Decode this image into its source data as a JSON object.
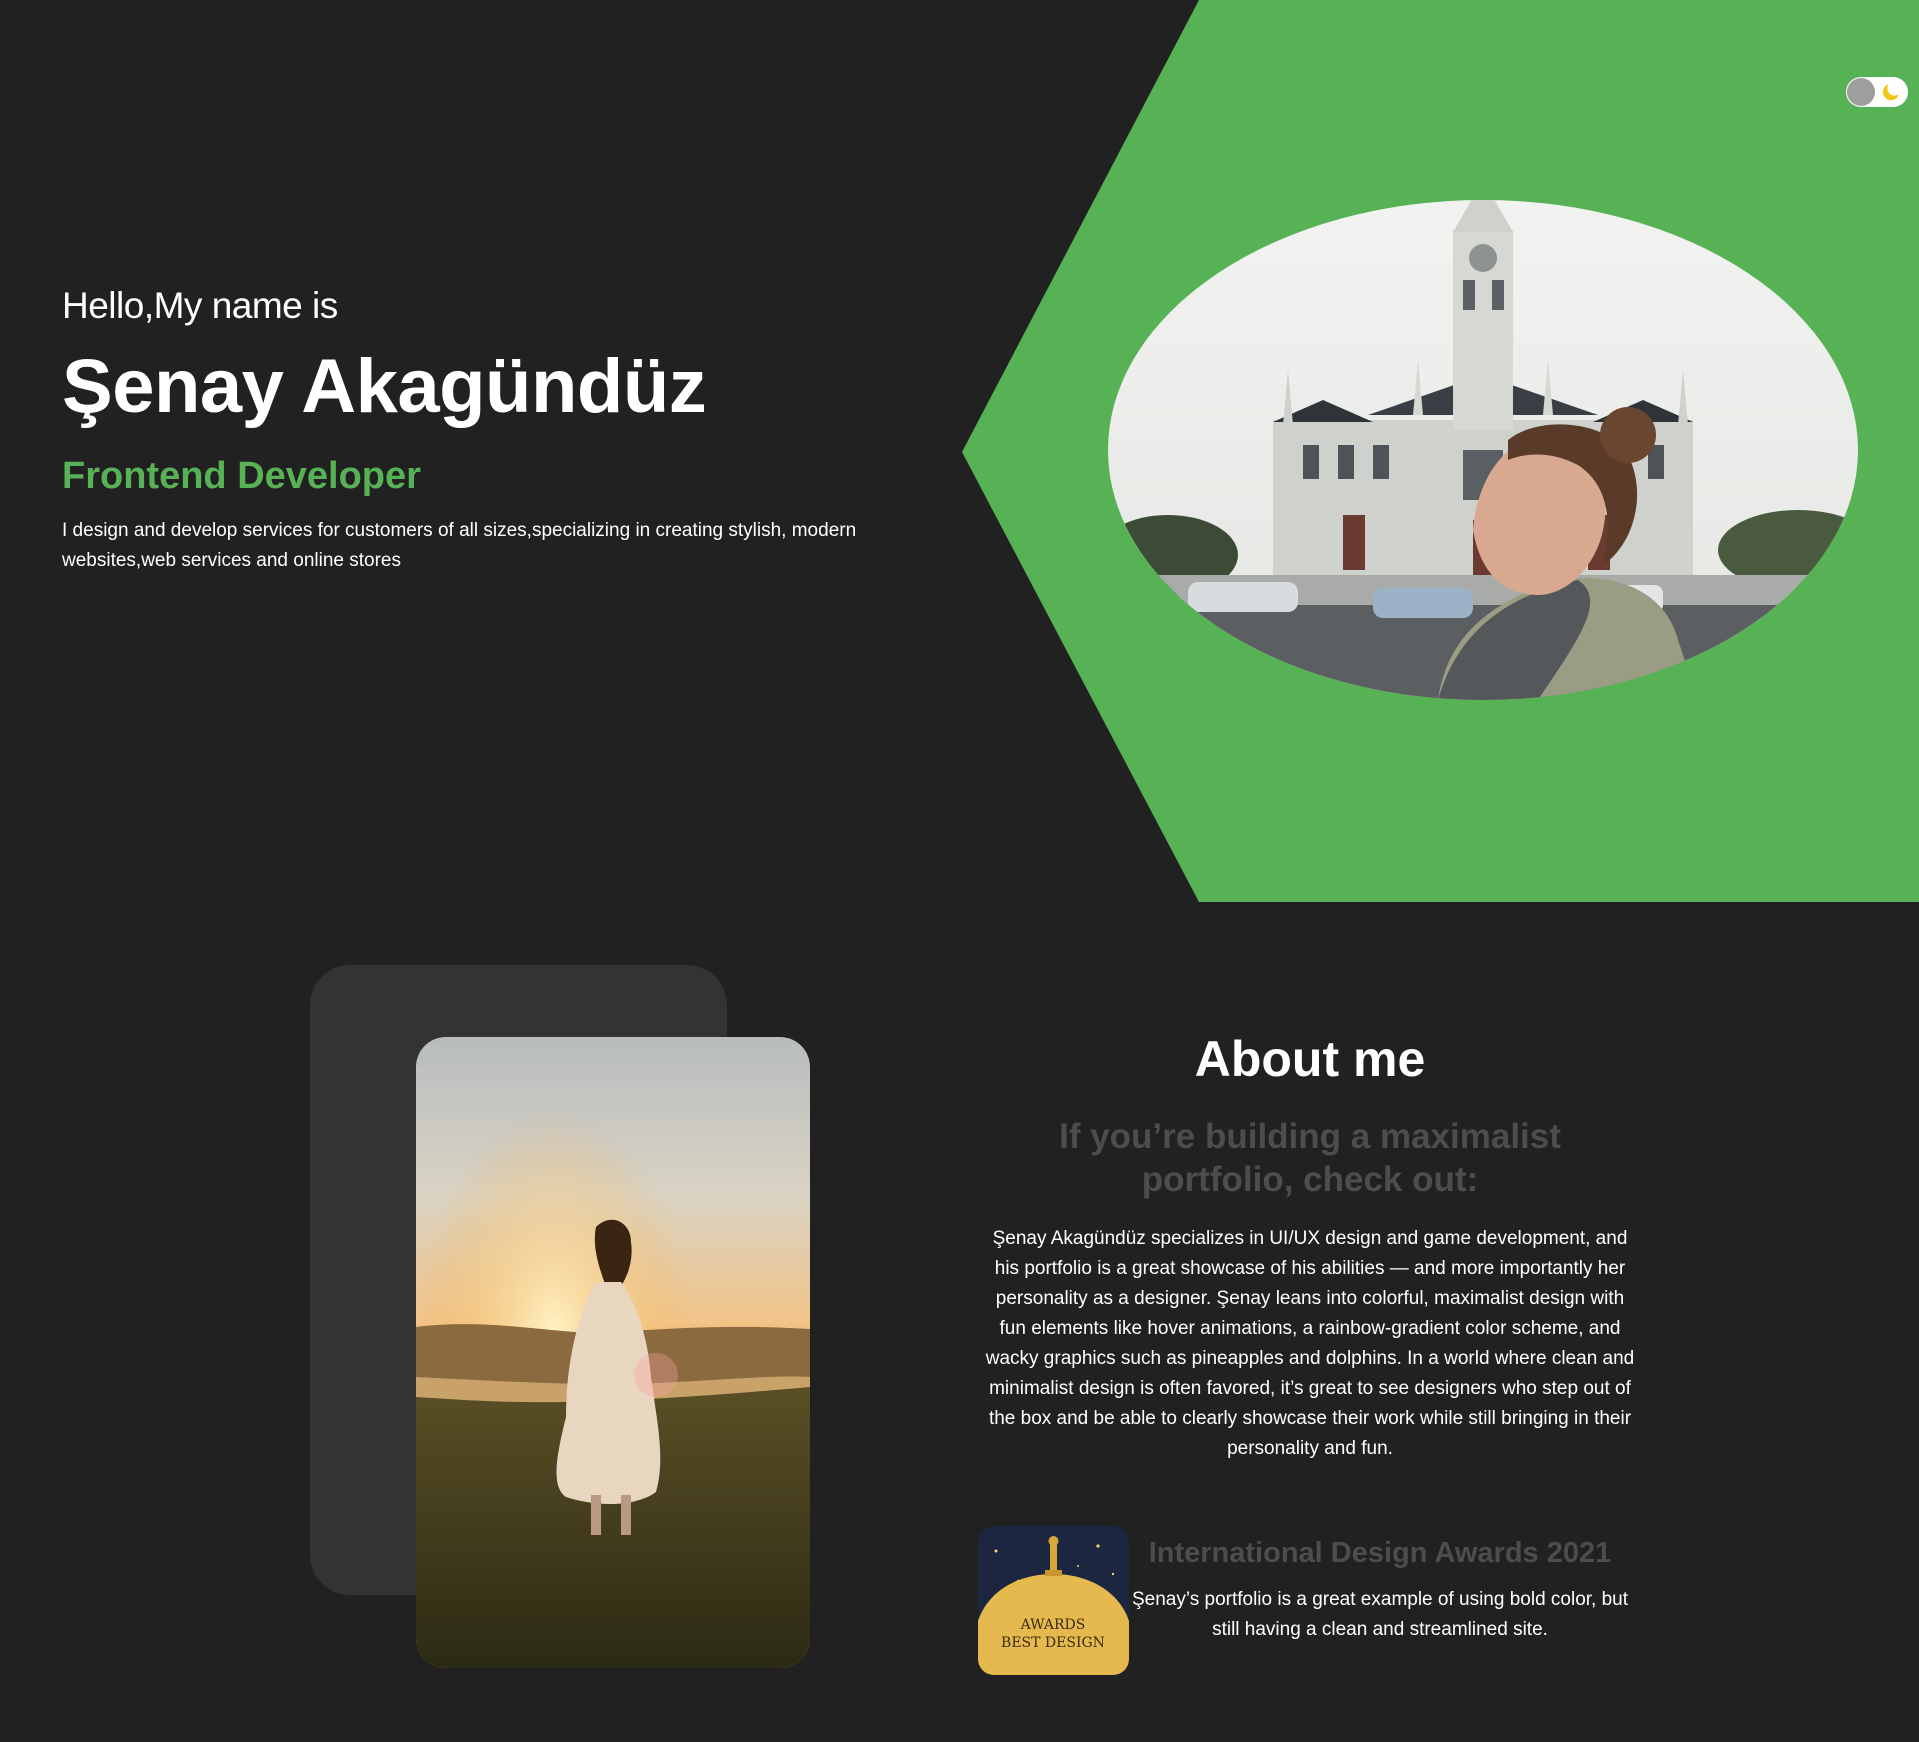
{
  "hero": {
    "greeting": "Hello,My name is",
    "name": "Şenay Akagündüz",
    "role": "Frontend Developer",
    "intro": "I design and develop services for customers of all sizes,specializing in creating stylish, modern websites,web services and online stores"
  },
  "theme_toggle": {
    "icon": "moon-icon",
    "mode": "dark"
  },
  "about": {
    "heading": "About me",
    "subheading": "If you’re building a maximalist portfolio, check out:",
    "body": "Şenay Akagündüz specializes in UI/UX design and game development, and his portfolio is a great showcase of his abilities — and more importantly her personality as a designer. Şenay leans into colorful, maximalist design with fun elements like hover animations, a rainbow-gradient color scheme, and wacky graphics such as pineapples and dolphins. In a world where clean and minimalist design is often favored, it’s great to see designers who step out of the box and be able to clearly showcase their work while still bringing in their personality and fun."
  },
  "award": {
    "title": "International Design Awards 2021",
    "description": "Şenay’s portfolio is a great example of using bold color, but still having a clean and streamlined site.",
    "badge_line1": "AWARDS",
    "badge_line2": "BEST DESIGN"
  },
  "colors": {
    "background": "#212121",
    "accent": "#57b256",
    "muted_heading": "#4d4d4d",
    "card": "#333333",
    "badge_navy": "#1c2640",
    "badge_gold": "#e6b94f"
  }
}
